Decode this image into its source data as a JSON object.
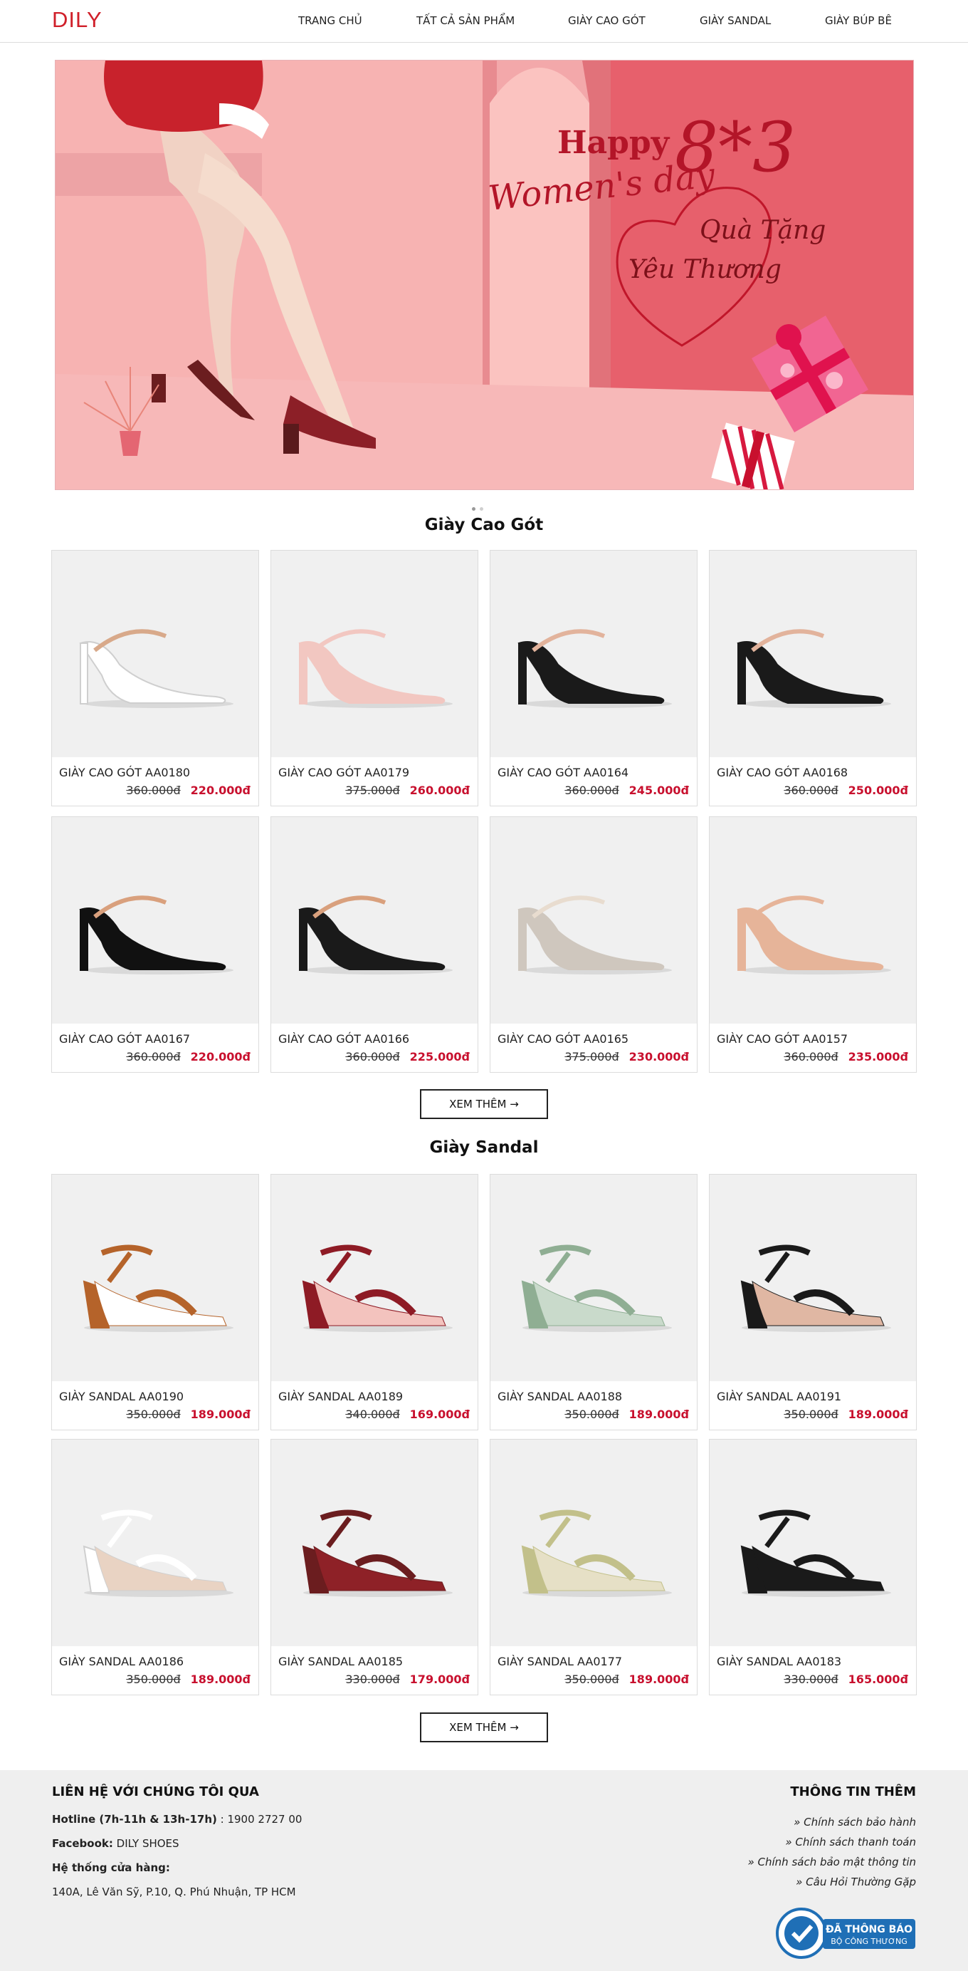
{
  "header": {
    "logo": "DILY",
    "nav": [
      "TRANG CHỦ",
      "TẤT CẢ SẢN PHẨM",
      "GIÀY CAO GÓT",
      "GIÀY SANDAL",
      "GIÀY BÚP BÊ"
    ]
  },
  "banner": {
    "happy": "Happy",
    "date": "8*3",
    "womens": "Women's day",
    "gift1": "Quà Tặng",
    "gift2": "Yêu Thương"
  },
  "sections": [
    {
      "title": "Giày Cao Gót",
      "button": "XEM THÊM →",
      "products": [
        {
          "name": "GIÀY CAO GÓT AA0180",
          "old": "360.000đ",
          "new": "220.000đ",
          "color": "#ffffff",
          "accent": "#d8a98a"
        },
        {
          "name": "GIÀY CAO GÓT AA0179",
          "old": "375.000đ",
          "new": "260.000đ",
          "color": "#f2c7c1",
          "accent": "#f2c7c1"
        },
        {
          "name": "GIÀY CAO GÓT AA0164",
          "old": "360.000đ",
          "new": "245.000đ",
          "color": "#1a1a1a",
          "accent": "#e2b39c"
        },
        {
          "name": "GIÀY CAO GÓT AA0168",
          "old": "360.000đ",
          "new": "250.000đ",
          "color": "#1a1a1a",
          "accent": "#e2b39c"
        },
        {
          "name": "GIÀY CAO GÓT AA0167",
          "old": "360.000đ",
          "new": "220.000đ",
          "color": "#111111",
          "accent": "#d9a07d"
        },
        {
          "name": "GIÀY CAO GÓT AA0166",
          "old": "360.000đ",
          "new": "225.000đ",
          "color": "#1a1a1a",
          "accent": "#d9a07d"
        },
        {
          "name": "GIÀY CAO GÓT AA0165",
          "old": "375.000đ",
          "new": "230.000đ",
          "color": "#cfc7be",
          "accent": "#e8dccf"
        },
        {
          "name": "GIÀY CAO GÓT AA0157",
          "old": "360.000đ",
          "new": "235.000đ",
          "color": "#e6b499",
          "accent": "#e6b499"
        }
      ]
    },
    {
      "title": "Giày Sandal",
      "button": "XEM THÊM →",
      "products": [
        {
          "name": "GIÀY SANDAL AA0190",
          "old": "350.000đ",
          "new": "189.000đ",
          "color": "#b5632a",
          "accent": "#ffffff"
        },
        {
          "name": "GIÀY SANDAL AA0189",
          "old": "340.000đ",
          "new": "169.000đ",
          "color": "#8e1b25",
          "accent": "#f3c3be"
        },
        {
          "name": "GIÀY SANDAL AA0188",
          "old": "350.000đ",
          "new": "189.000đ",
          "color": "#8fae93",
          "accent": "#c9dacb"
        },
        {
          "name": "GIÀY SANDAL AA0191",
          "old": "350.000đ",
          "new": "189.000đ",
          "color": "#1a1a1a",
          "accent": "#e0b7a3"
        },
        {
          "name": "GIÀY SANDAL AA0186",
          "old": "350.000đ",
          "new": "189.000đ",
          "color": "#ffffff",
          "accent": "#e9d3c3"
        },
        {
          "name": "GIÀY SANDAL AA0185",
          "old": "330.000đ",
          "new": "179.000đ",
          "color": "#6b1d1f",
          "accent": "#8e2127"
        },
        {
          "name": "GIÀY SANDAL AA0177",
          "old": "350.000đ",
          "new": "189.000đ",
          "color": "#c2c08a",
          "accent": "#e6e0c6"
        },
        {
          "name": "GIÀY SANDAL AA0183",
          "old": "330.000đ",
          "new": "165.000đ",
          "color": "#1a1a1a",
          "accent": "#1a1a1a"
        }
      ]
    }
  ],
  "footer": {
    "contact_title": "LIÊN HỆ VỚI CHÚNG TÔI QUA",
    "hotline_label": "Hotline (7h-11h & 13h-17h)",
    "hotline_value": ": 1900 2727 00",
    "facebook_label": "Facebook:",
    "facebook_value": "DILY SHOES",
    "stores_label": "Hệ thống cửa hàng:",
    "address": "140A, Lê Văn Sỹ, P.10, Q. Phú Nhuận, TP HCM",
    "info_title": "THÔNG TIN THÊM",
    "links": [
      "» Chính sách bảo hành",
      "» Chính sách thanh toán",
      "» Chính sách bảo mật thông tin",
      "» Câu Hỏi Thường Gặp"
    ],
    "badge_line1": "ĐÃ THÔNG BÁO",
    "badge_line2": "BỘ CÔNG THƯƠNG"
  },
  "colors": {
    "brand": "#d0202a",
    "sale": "#c8102e",
    "footer_bg": "#efefef"
  }
}
